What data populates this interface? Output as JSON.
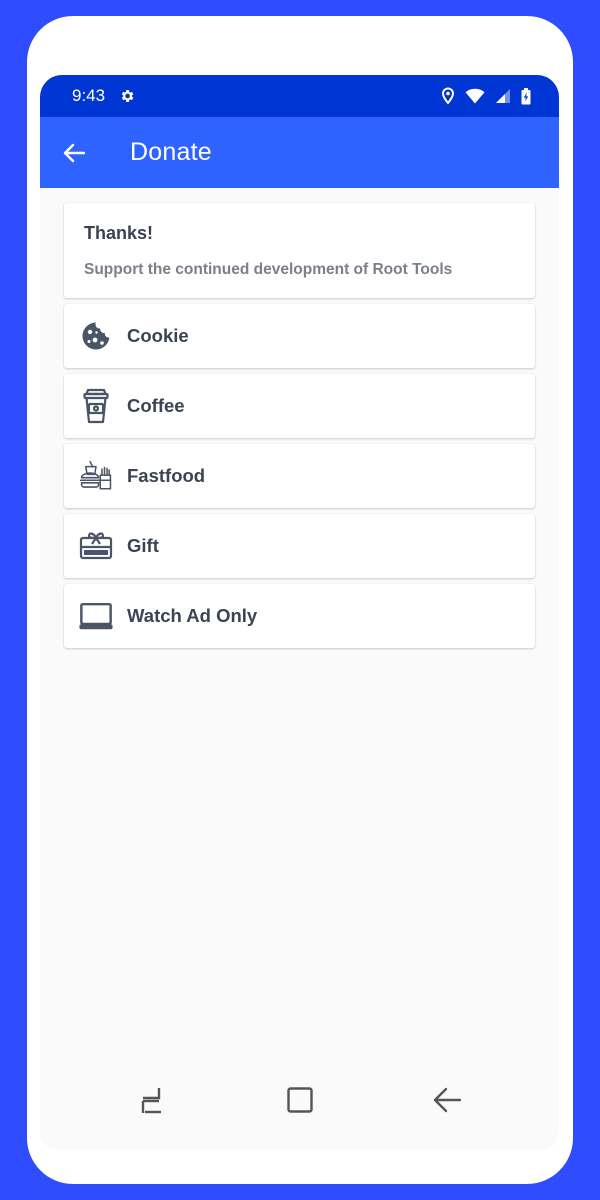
{
  "status_bar": {
    "time": "9:43"
  },
  "app_bar": {
    "title": "Donate"
  },
  "info_card": {
    "title": "Thanks!",
    "subtitle": "Support the continued development of Root Tools"
  },
  "items": [
    {
      "label": "Cookie",
      "icon": "cookie-icon"
    },
    {
      "label": "Coffee",
      "icon": "coffee-cup-icon"
    },
    {
      "label": "Fastfood",
      "icon": "fastfood-icon"
    },
    {
      "label": "Gift",
      "icon": "gift-card-icon"
    },
    {
      "label": "Watch Ad Only",
      "icon": "laptop-icon"
    }
  ],
  "colors": {
    "status_bar": "#0037d4",
    "app_bar": "#2e63ff",
    "frame_background": "#2f4cff",
    "icon_color": "#4a5567"
  }
}
